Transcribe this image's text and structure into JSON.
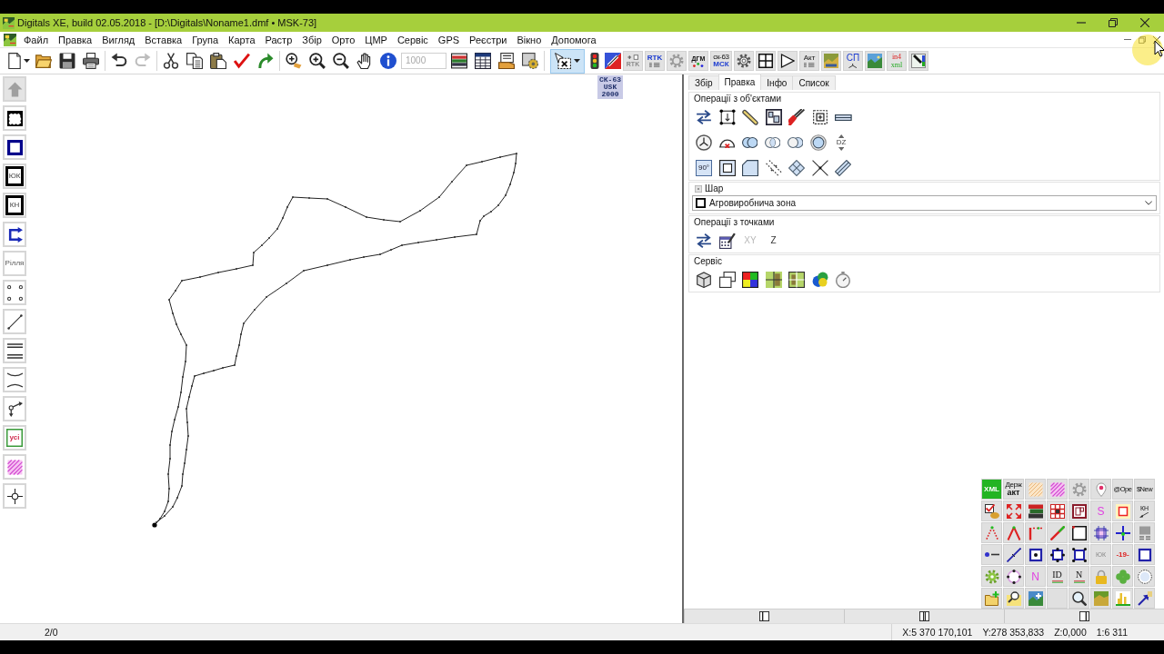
{
  "window": {
    "title": "Digitals XE, build 02.05.2018 - [D:\\Digitals\\Noname1.dmf • MSK-73]"
  },
  "menu": [
    "Файл",
    "Правка",
    "Вигляд",
    "Вставка",
    "Група",
    "Карта",
    "Растр",
    "Збір",
    "Орто",
    "ЦМР",
    "Сервіс",
    "GPS",
    "Реєстри",
    "Вікно",
    "Допомога"
  ],
  "toolbar": {
    "redo": {
      "disabled": true
    },
    "scale_field": {
      "value": "1000",
      "disabled": true
    },
    "select_tool": {
      "pressed": true
    },
    "text_buttons": [
      {
        "lines": [
          "RTK"
        ]
      },
      {
        "lines": [
          "RTK"
        ]
      },
      {
        "lines": [
          "ДГМ"
        ]
      },
      {
        "lines": [
          "ск-63",
          "МСК"
        ]
      },
      {
        "lines": [
          "Акт"
        ]
      },
      {
        "lines": [
          "СП"
        ]
      },
      {
        "lines": [
          "in4",
          "xml"
        ]
      }
    ]
  },
  "left_toolbar": {
    "up_button": {
      "disabled": true
    },
    "labels": [
      "ЮК",
      "КН",
      "Рілля",
      "усі"
    ]
  },
  "canvas": {
    "crs_label": [
      "СК-63",
      "USK",
      "2000"
    ]
  },
  "panel": {
    "tabs": [
      {
        "label": "Збір",
        "selected": false
      },
      {
        "label": "Правка",
        "selected": true
      },
      {
        "label": "Інфо",
        "selected": false
      },
      {
        "label": "Список",
        "selected": false
      }
    ],
    "object_ops": {
      "title": "Операції з об'єктами",
      "labels": [
        "DZ",
        "90°"
      ]
    },
    "layer": {
      "title": "Шар",
      "value": "Агровиробнича зона"
    },
    "point_ops": {
      "title": "Операції з точками",
      "buttons": [
        {
          "label": "XY",
          "disabled": true
        },
        {
          "label": "Z",
          "disabled": false
        }
      ]
    },
    "service": {
      "title": "Сервіс"
    },
    "tool_grid": {
      "labels": [
        {
          "lines": [
            "XML"
          ]
        },
        {
          "lines": [
            "Держ",
            "акт"
          ]
        },
        {
          "lines": [
            "@Ope"
          ]
        },
        {
          "lines": [
            "$New"
          ]
        },
        {
          "lines": [
            "S"
          ]
        },
        {
          "lines": [
            "КН"
          ]
        },
        {
          "lines": [
            "ЮК"
          ]
        },
        {
          "lines": [
            "-19-"
          ]
        },
        {
          "lines": [
            "N"
          ]
        },
        {
          "lines": [
            "ID"
          ]
        },
        {
          "lines": [
            "N"
          ]
        }
      ]
    }
  },
  "status_bar": {
    "selection": "2/0",
    "x": "X:5 370 170,101",
    "y": "Y:278 353,833",
    "z": "Z:0,000",
    "scale": "1:6 311"
  }
}
